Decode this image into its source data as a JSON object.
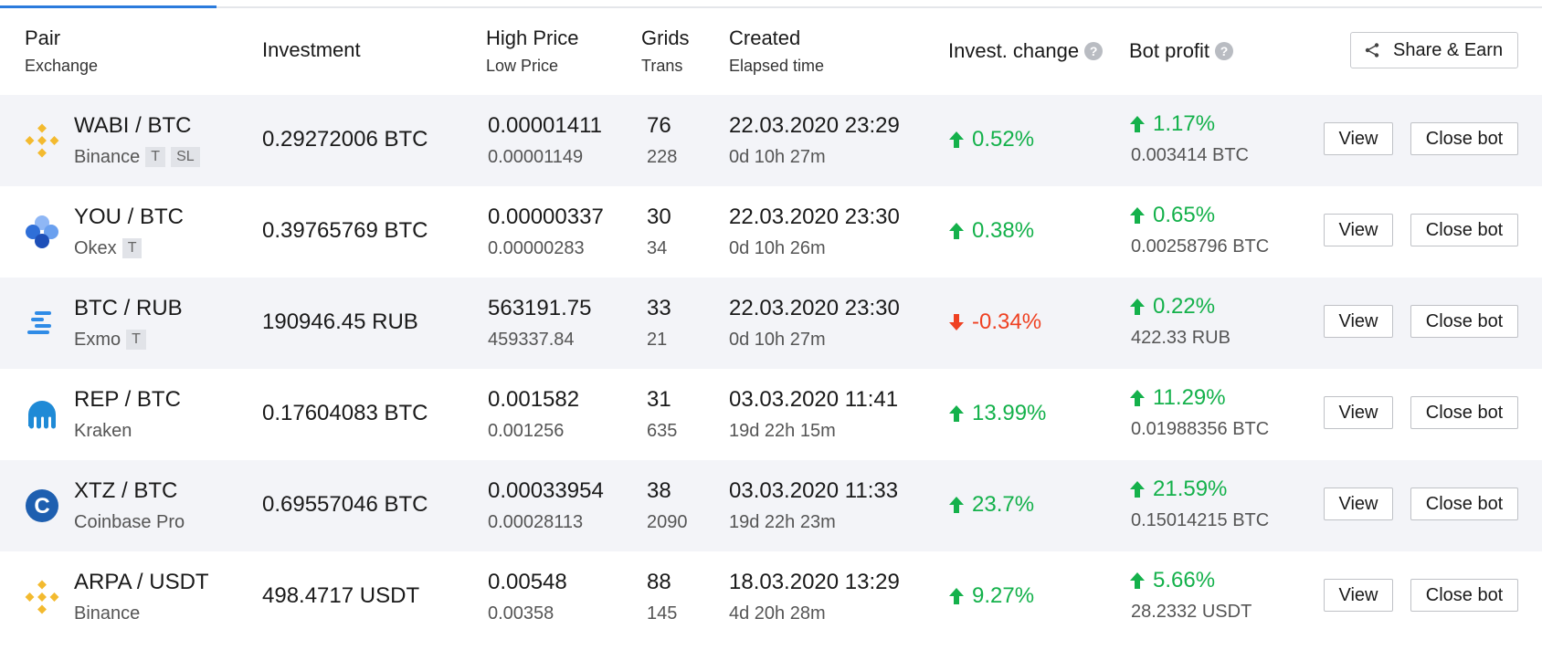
{
  "header": {
    "pair": "Pair",
    "exchange": "Exchange",
    "investment": "Investment",
    "high_price": "High Price",
    "low_price": "Low Price",
    "grids": "Grids",
    "trans": "Trans",
    "created": "Created",
    "elapsed": "Elapsed time",
    "invest_change": "Invest. change",
    "bot_profit": "Bot profit",
    "help": "?",
    "share_label": "Share & Earn"
  },
  "colors": {
    "accent": "#2b7bdc",
    "positive": "#14b14b",
    "negative": "#ef4122",
    "row_shade": "#f3f4f8"
  },
  "rows": [
    {
      "icon": "binance-icon",
      "pair": "WABI / BTC",
      "exchange": "Binance",
      "tags": [
        "T",
        "SL"
      ],
      "investment": "0.29272006 BTC",
      "high": "0.00001411",
      "low": "0.00001149",
      "grids": "76",
      "trans": "228",
      "created": "22.03.2020 23:29",
      "elapsed": "0d 10h 27m",
      "change": "0.52%",
      "change_dir": "up",
      "profit": "1.17%",
      "profit_amount": "0.003414 BTC",
      "view": "View",
      "close": "Close bot"
    },
    {
      "icon": "okex-icon",
      "pair": "YOU / BTC",
      "exchange": "Okex",
      "tags": [
        "T"
      ],
      "investment": "0.39765769 BTC",
      "high": "0.00000337",
      "low": "0.00000283",
      "grids": "30",
      "trans": "34",
      "created": "22.03.2020 23:30",
      "elapsed": "0d 10h 26m",
      "change": "0.38%",
      "change_dir": "up",
      "profit": "0.65%",
      "profit_amount": "0.00258796 BTC",
      "view": "View",
      "close": "Close bot"
    },
    {
      "icon": "exmo-icon",
      "pair": "BTC / RUB",
      "exchange": "Exmo",
      "tags": [
        "T"
      ],
      "investment": "190946.45 RUB",
      "high": "563191.75",
      "low": "459337.84",
      "grids": "33",
      "trans": "21",
      "created": "22.03.2020 23:30",
      "elapsed": "0d 10h 27m",
      "change": "-0.34%",
      "change_dir": "down",
      "profit": "0.22%",
      "profit_amount": "422.33 RUB",
      "view": "View",
      "close": "Close bot"
    },
    {
      "icon": "kraken-icon",
      "pair": "REP / BTC",
      "exchange": "Kraken",
      "tags": [],
      "investment": "0.17604083 BTC",
      "high": "0.001582",
      "low": "0.001256",
      "grids": "31",
      "trans": "635",
      "created": "03.03.2020 11:41",
      "elapsed": "19d 22h 15m",
      "change": "13.99%",
      "change_dir": "up",
      "profit": "11.29%",
      "profit_amount": "0.01988356 BTC",
      "view": "View",
      "close": "Close bot"
    },
    {
      "icon": "coinbase-icon",
      "pair": "XTZ / BTC",
      "exchange": "Coinbase Pro",
      "tags": [],
      "investment": "0.69557046 BTC",
      "high": "0.00033954",
      "low": "0.00028113",
      "grids": "38",
      "trans": "2090",
      "created": "03.03.2020 11:33",
      "elapsed": "19d 22h 23m",
      "change": "23.7%",
      "change_dir": "up",
      "profit": "21.59%",
      "profit_amount": "0.15014215 BTC",
      "view": "View",
      "close": "Close bot"
    },
    {
      "icon": "binance-icon",
      "pair": "ARPA / USDT",
      "exchange": "Binance",
      "tags": [],
      "investment": "498.4717 USDT",
      "high": "0.00548",
      "low": "0.00358",
      "grids": "88",
      "trans": "145",
      "created": "18.03.2020 13:29",
      "elapsed": "4d 20h 28m",
      "change": "9.27%",
      "change_dir": "up",
      "profit": "5.66%",
      "profit_amount": "28.2332 USDT",
      "view": "View",
      "close": "Close bot"
    }
  ]
}
